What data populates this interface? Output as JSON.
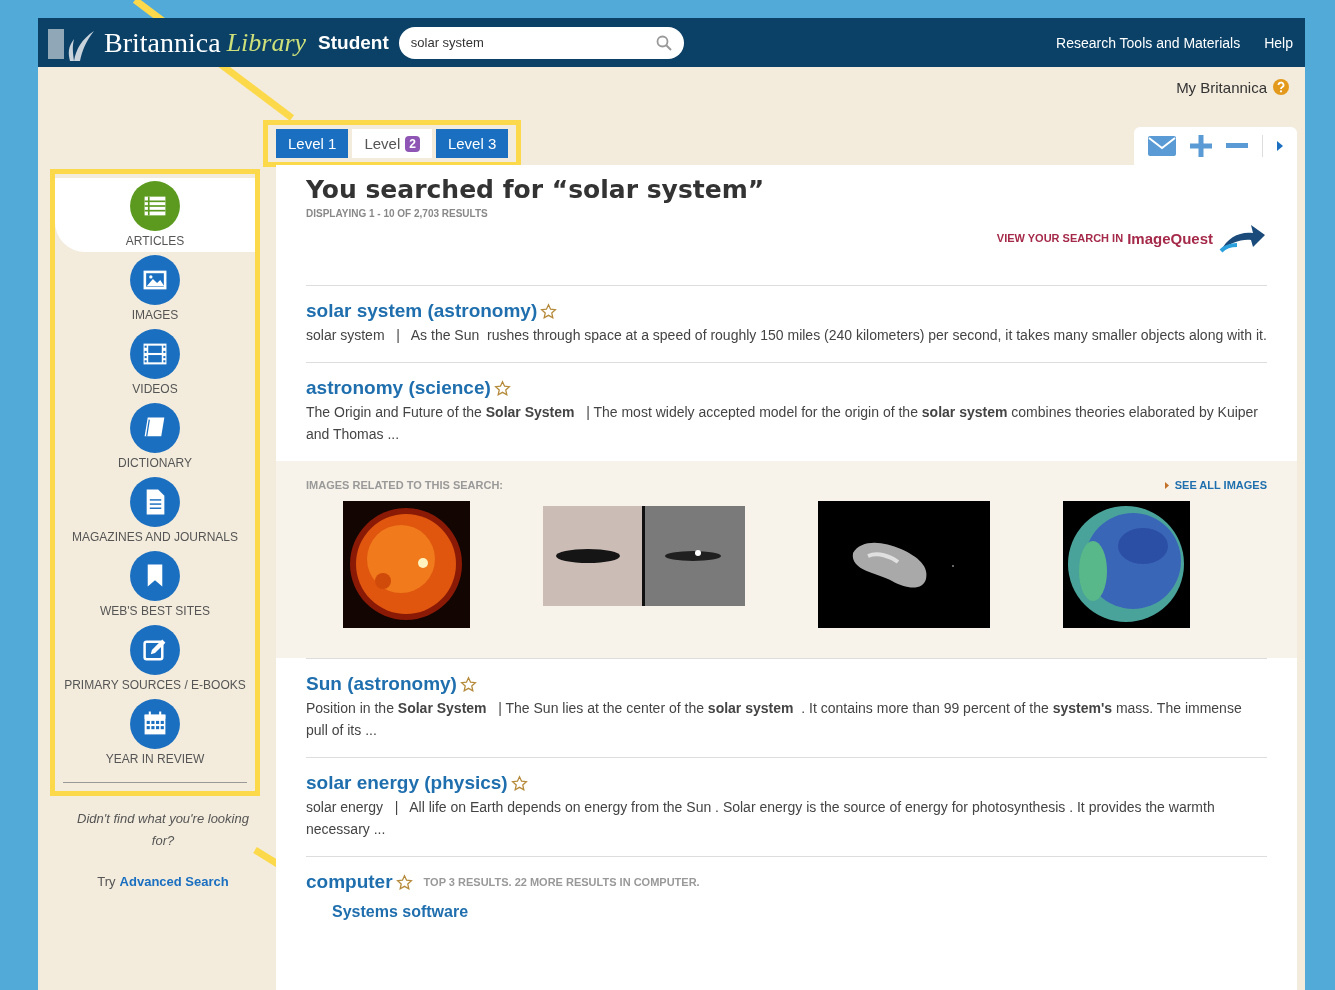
{
  "header": {
    "logo": {
      "name": "Britannica",
      "library": "Library",
      "edition": "Student"
    },
    "search": {
      "value": "solar system"
    },
    "links": [
      "Research Tools and Materials",
      "Help"
    ]
  },
  "account": {
    "label": "My Britannica"
  },
  "level_tabs": [
    {
      "label": "Level 1",
      "selected": false
    },
    {
      "label": "Level",
      "badge": "2",
      "selected": true
    },
    {
      "label": "Level 3",
      "selected": false
    }
  ],
  "sidebar": {
    "items": [
      {
        "label": "ARTICLES",
        "selected": true
      },
      {
        "label": "IMAGES",
        "selected": false
      },
      {
        "label": "VIDEOS",
        "selected": false
      },
      {
        "label": "DICTIONARY",
        "selected": false
      },
      {
        "label": "MAGAZINES AND JOURNALS",
        "selected": false
      },
      {
        "label": "WEB'S BEST SITES",
        "selected": false
      },
      {
        "label": "PRIMARY SOURCES / E-BOOKS",
        "selected": false
      },
      {
        "label": "YEAR IN REVIEW",
        "selected": false
      }
    ],
    "help_text": "Didn't find what you're looking for?",
    "try_prefix": "Try",
    "try_link": "Advanced Search"
  },
  "results": {
    "heading": "You searched for “solar system”",
    "count": "DISPLAYING 1 - 10 OF 2,703 RESULTS",
    "imagequest": {
      "prefix": "VIEW YOUR SEARCH IN",
      "brand": "ImageQuest"
    },
    "items": [
      {
        "kind": "article",
        "title": "solar system (astronomy)",
        "snippet": "solar system   |   As the Sun  rushes through space at a speed of roughly 150 miles (240 kilometers) per second, it takes many smaller objects along with it."
      },
      {
        "kind": "article",
        "title": "astronomy (science)",
        "snippet": "The Origin and Future of the **Solar System**   | The most widely accepted model for the origin of the **solar system** combines theories elaborated by Kuiper and Thomas ..."
      },
      {
        "kind": "images",
        "label": "IMAGES RELATED TO THIS SEARCH:",
        "see_all": "SEE ALL IMAGES"
      },
      {
        "kind": "article",
        "title": "Sun (astronomy)",
        "snippet": "Position in the **Solar System**   | The Sun lies at the center of the **solar system**  . It contains more than 99 percent of the **system's** mass. The immense pull of its ..."
      },
      {
        "kind": "article",
        "title": "solar energy (physics)",
        "snippet": "solar energy   |   All life on Earth depends on energy from the Sun . Solar energy is the source of energy for photosynthesis . It provides the warmth necessary ..."
      },
      {
        "kind": "group",
        "title": "computer",
        "note": "TOP 3 RESULTS. 22 MORE RESULTS IN COMPUTER.",
        "children": [
          "Systems software"
        ]
      }
    ]
  }
}
